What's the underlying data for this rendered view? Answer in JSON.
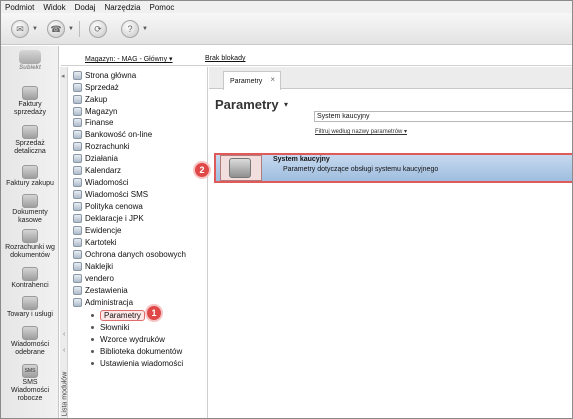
{
  "menu": [
    "Podmiot",
    "Widok",
    "Dodaj",
    "Narzędzia",
    "Pomoc"
  ],
  "header": {
    "warehouse": "Magazyn: - MAG - Główny ▾",
    "lock_status": "Brak blokady"
  },
  "app": {
    "logo_text": "Subiekt"
  },
  "left_panel": [
    "Faktury sprzedaży",
    "Sprzedaż detaliczna",
    "Faktury zakupu",
    "Dokumenty kasowe",
    "Rozrachunki wg dokumentów",
    "Kontrahenci",
    "Towary i usługi",
    "Wiadomości odebrane",
    "SMS Wiadomości robocze"
  ],
  "sms_badge": "SMS",
  "modules": {
    "vertical_label": "Lista modułów",
    "items": [
      "Strona główna",
      "Sprzedaż",
      "Zakup",
      "Magazyn",
      "Finanse",
      "Bankowość on-line",
      "Rozrachunki",
      "Działania",
      "Kalendarz",
      "Wiadomości",
      "Wiadomości SMS",
      "Polityka cenowa",
      "Deklaracje i JPK",
      "Ewidencje",
      "Kartoteki",
      "Ochrona danych osobowych",
      "Naklejki",
      "vendero",
      "Zestawienia",
      "Administracja"
    ],
    "sub_items": [
      "Parametry",
      "Słowniki",
      "Wzorce wydruków",
      "Biblioteka dokumentów",
      "Ustawienia wiadomości"
    ]
  },
  "tab": {
    "label": "Parametry",
    "close": "×"
  },
  "content": {
    "title": "Parametry",
    "search_value": "System kaucyjny",
    "filter_link": "Filtruj według nazwy parametrów ▾",
    "result": {
      "title": "System kaucyjny",
      "description": "Parametry dotyczące obsługi systemu kaucyjnego"
    }
  },
  "callouts": [
    "1",
    "2"
  ]
}
